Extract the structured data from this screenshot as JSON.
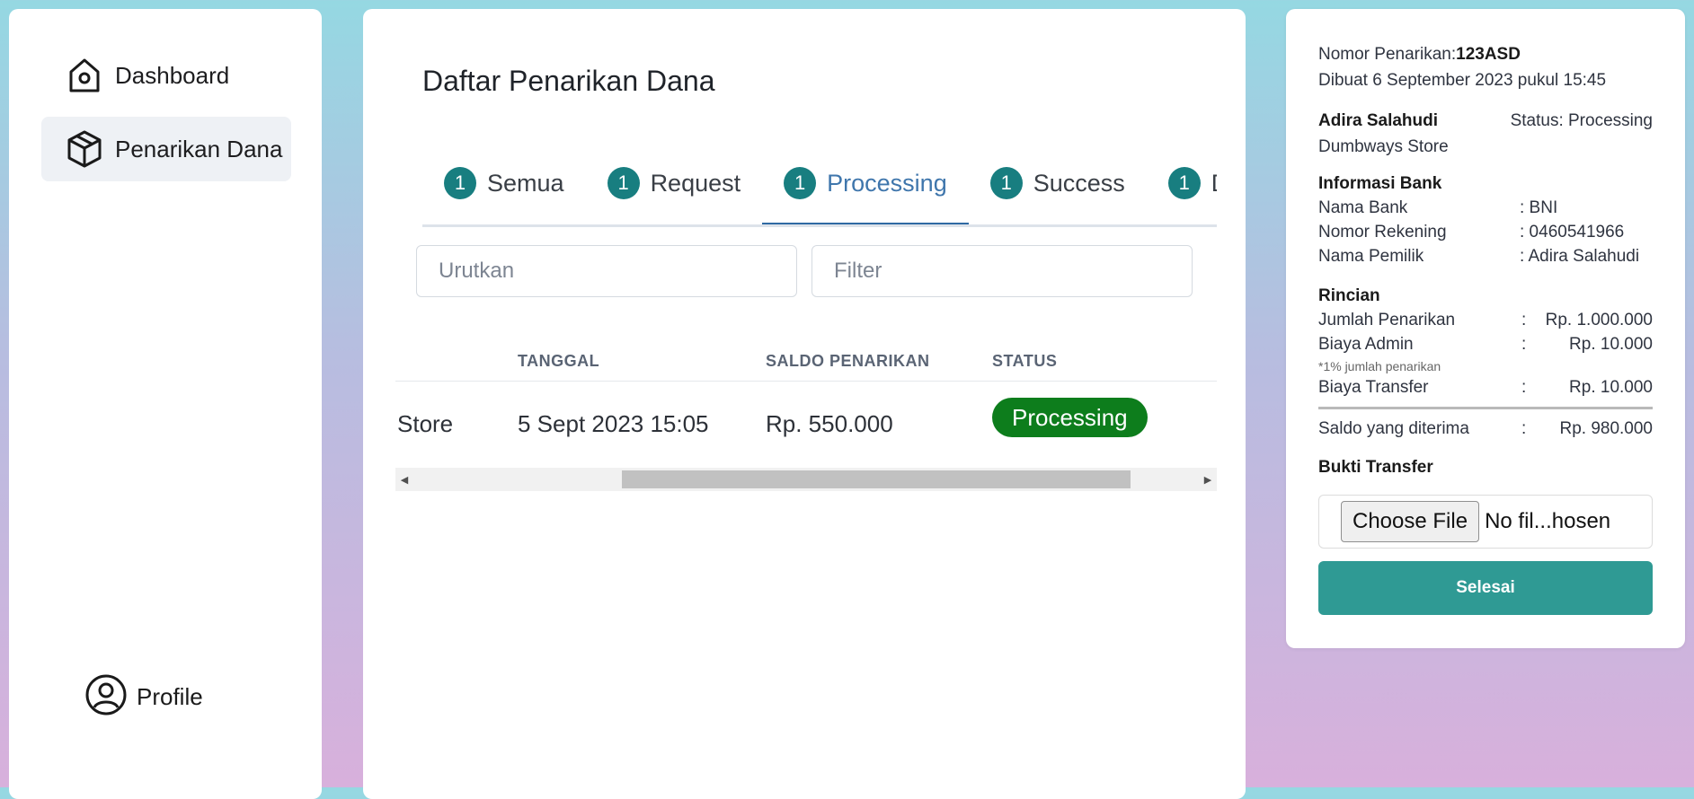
{
  "sidebar": {
    "items": [
      {
        "label": "Dashboard",
        "icon": "home-icon"
      },
      {
        "label": "Penarikan Dana",
        "icon": "package-icon"
      }
    ],
    "profile": {
      "label": "Profile",
      "icon": "user-circle-icon"
    }
  },
  "main": {
    "title": "Daftar Penarikan Dana",
    "tabs": [
      {
        "count": "1",
        "label": "Semua"
      },
      {
        "count": "1",
        "label": "Request"
      },
      {
        "count": "1",
        "label": "Processing"
      },
      {
        "count": "1",
        "label": "Success"
      },
      {
        "count": "1",
        "label": "De"
      }
    ],
    "active_tab": "Processing",
    "sort": {
      "placeholder": "Urutkan"
    },
    "filter": {
      "placeholder": "Filter"
    },
    "table": {
      "headers": [
        "TANGGAL",
        "SALDO PENARIKAN",
        "STATUS"
      ],
      "rows": [
        {
          "store": "Store",
          "tanggal": "5 Sept 2023 15:05",
          "saldo": "Rp. 550.000",
          "status": "Processing"
        }
      ]
    }
  },
  "detail": {
    "nomor_label": "Nomor Penarikan:",
    "nomor_value": "123ASD",
    "created": "Dibuat 6 September 2023 pukul 15:45",
    "customer_name": "Adira Salahudi",
    "status_text": "Status: Processing",
    "store": "Dumbways Store",
    "bank_section": "Informasi Bank",
    "bank": [
      {
        "label": "Nama Bank",
        "value": ": BNI"
      },
      {
        "label": "Nomor Rekening",
        "value": ": 0460541966"
      },
      {
        "label": "Nama Pemilik",
        "value": ": Adira Salahudi"
      }
    ],
    "rincian_section": "Rincian",
    "rincian": {
      "jumlah_label": "Jumlah Penarikan",
      "jumlah_value": "Rp. 1.000.000",
      "admin_label": "Biaya Admin",
      "admin_value": "Rp. 10.000",
      "admin_note": "*1% jumlah penarikan",
      "transfer_label": "Biaya Transfer",
      "transfer_value": "Rp. 10.000",
      "colon": ":"
    },
    "saldo_label": "Saldo yang diterima",
    "saldo_value": "Rp. 980.000",
    "bukti_label": "Bukti Transfer",
    "file_button": "Choose File",
    "file_name": "No fil...hosen",
    "submit": "Selesai"
  },
  "colors": {
    "accent": "#187e80",
    "active_tab": "#2f6aa3",
    "status_processing": "#0d7d1c",
    "submit_button": "#2f9a94"
  }
}
